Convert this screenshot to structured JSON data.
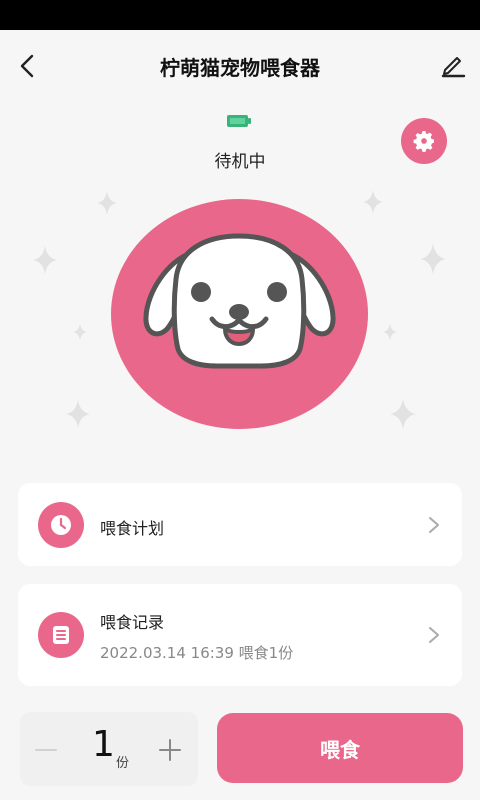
{
  "header": {
    "title": "柠萌猫宠物喂食器",
    "back_icon": "chevron-left-icon",
    "edit_icon": "pencil-icon"
  },
  "device": {
    "battery_icon": "battery-icon",
    "status_text": "待机中",
    "settings_icon": "gear-icon"
  },
  "hero": {
    "illustration": "dog-face-icon"
  },
  "cards": {
    "plan": {
      "label": "喂食计划",
      "icon": "clock-icon"
    },
    "record": {
      "label": "喂食记录",
      "subtitle": "2022.03.14 16:39 喂食1份",
      "icon": "list-icon"
    }
  },
  "feeder": {
    "quantity": "1",
    "unit": "份",
    "feed_label": "喂食"
  },
  "colors": {
    "accent": "#e9678a",
    "battery": "#3bb27a",
    "background": "#f6f6f6"
  }
}
